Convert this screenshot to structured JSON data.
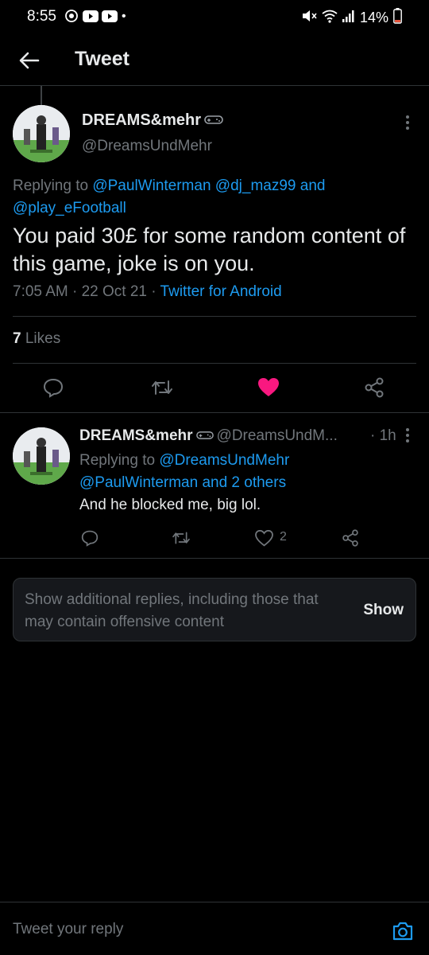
{
  "status_bar": {
    "time": "8:55",
    "battery": "14%",
    "left_icons": [
      "sync-icon",
      "youtube-icon",
      "youtube-icon"
    ],
    "right_icons": [
      "mute-icon",
      "wifi-icon",
      "signal-icon",
      "battery-icon"
    ]
  },
  "header": {
    "title": "Tweet"
  },
  "main_tweet": {
    "author_name": "DREAMS&mehr",
    "author_handle": "@DreamsUndMehr",
    "replying_prefix": "Replying to",
    "replying_to": [
      "@PaulWinterman",
      "@dj_maz99"
    ],
    "replying_and": "and",
    "replying_last": "@play_eFootball",
    "text": "You paid 30£ for some random content of this game, joke is on you.",
    "time": "7:05 AM",
    "date": "22 Oct 21",
    "sep": "·",
    "source": "Twitter for Android",
    "likes_count": "7",
    "likes_label": "Likes",
    "liked": true
  },
  "reply_tweet": {
    "author_name": "DREAMS&mehr",
    "author_handle": "@DreamsUndM...",
    "time": "· 1h",
    "replying_prefix": "Replying to",
    "replying_to": "@DreamsUndMehr",
    "replying_rest": "@PaulWinterman and 2 others",
    "text": "And he blocked me, big lol.",
    "like_count": "2"
  },
  "additional_replies": {
    "text": "Show additional replies, including those that may contain offensive content",
    "button": "Show"
  },
  "compose": {
    "placeholder": "Tweet your reply"
  },
  "colors": {
    "background": "#000000",
    "accent": "#1d9bf0",
    "like": "#f91880",
    "muted": "#71767b",
    "text": "#e7e9ea"
  }
}
